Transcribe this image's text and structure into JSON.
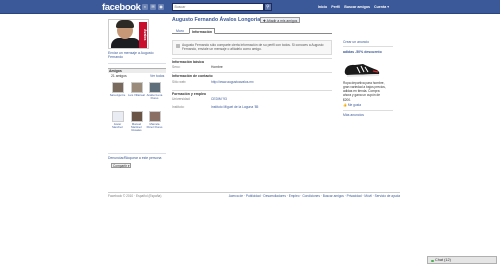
{
  "topbar": {
    "logo": "facebook",
    "search_placeholder": "Buscar",
    "nav": [
      "Inicio",
      "Perfil",
      "Buscar amigos",
      "Cuenta ▾"
    ]
  },
  "profile": {
    "name": "Augusto Fernando Ávalos Longoria",
    "add_friend": "Añadir a mis amigos",
    "pic_text": "Ávalos",
    "message_link": "Enviar un mensaje a Augusto Fernando"
  },
  "tabs": [
    "Muro",
    "Información"
  ],
  "notice": {
    "text": "Augusto Fernando sólo comparte cierta información de su perfil con todos. Si conoces a Augusto Fernando, envíale un mensaje o añádelo como amigo."
  },
  "friends": {
    "header": "Amigos",
    "count": "21 amigos",
    "see_all": "Ver todos",
    "list": [
      {
        "name": "Sara Aguirre",
        "color": "#7a6a5e"
      },
      {
        "name": "Luis Villarreal",
        "color": "#9a8b7a"
      },
      {
        "name": "Anabel Luna Flores",
        "color": "#5e6e7a"
      },
      {
        "name": "Javier Sánchez",
        "color": "#e9edf3"
      },
      {
        "name": "Manuel Martinez Rosales",
        "color": "#6a5446"
      },
      {
        "name": "Marcela Pérez Flores",
        "color": "#8a7064"
      }
    ]
  },
  "side": {
    "actions": "Denunciar/Bloquear a este persona",
    "share": "Compartir ▾"
  },
  "info": {
    "basic_title": "Información básica",
    "sex_label": "Sexo:",
    "sex_value": "Hombre",
    "contact_title": "Información de contacto",
    "web_label": "Sitio web:",
    "web_value": "http://www.augustoavalos.mx",
    "edu_title": "Formación y empleo",
    "uni_label": "Universidad:",
    "uni_value": "CEDIM '93",
    "school_label": "Instituto:",
    "school_value": "Instituto Miguel de la Laguna '85"
  },
  "ad": {
    "create": "Crear un anuncio",
    "title": "adidas -50% descuento",
    "text": "Ropa deportiva para hombre, gran variedad a bajos precios, adidas en tienda. Compra ahora y gana un cupón de $200.",
    "like": "Me gusta",
    "more": "Más anuncios"
  },
  "footer": {
    "left": "Facebook © 2010 · Español (España)",
    "right": "Acerca de · Publicidad · Desarrolladores · Empleo · Condiciones · Buscar amigos · Privacidad · Móvil · Servicio de ayuda"
  },
  "chat": {
    "label": "Chat (12)"
  }
}
